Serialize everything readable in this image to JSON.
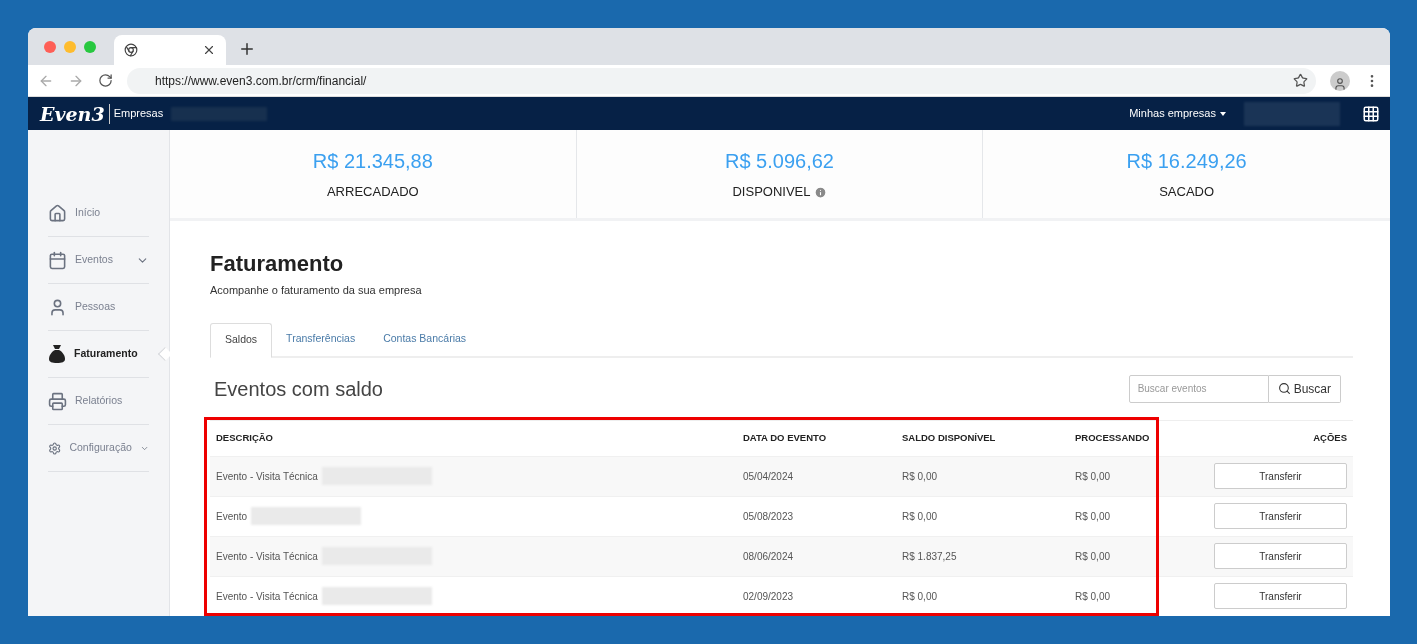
{
  "browser": {
    "url": "https://www.even3.com.br/crm/financial/"
  },
  "header": {
    "logo": "Even3",
    "product": "Empresas",
    "company_redacted": true,
    "menu": "Minhas empresas",
    "user_redacted": true
  },
  "sidebar": {
    "items": [
      {
        "label": "Início",
        "selected": false,
        "expandable": false
      },
      {
        "label": "Eventos",
        "selected": false,
        "expandable": true
      },
      {
        "label": "Pessoas",
        "selected": false,
        "expandable": false
      },
      {
        "label": "Faturamento",
        "selected": true,
        "expandable": false
      },
      {
        "label": "Relatórios",
        "selected": false,
        "expandable": false
      },
      {
        "label": "Configuração",
        "selected": false,
        "expandable": true
      }
    ]
  },
  "stats": [
    {
      "value": "R$ 21.345,88",
      "label": "ARRECADADO",
      "info": false
    },
    {
      "value": "R$ 5.096,62",
      "label": "DISPONIVEL",
      "info": true
    },
    {
      "value": "R$ 16.249,26",
      "label": "SACADO",
      "info": false
    }
  ],
  "page": {
    "title": "Faturamento",
    "subtitle": "Acompanhe o faturamento da sua empresa"
  },
  "tabs": [
    {
      "label": "Saldos",
      "selected": true
    },
    {
      "label": "Transferências",
      "selected": false
    },
    {
      "label": "Contas Bancárias",
      "selected": false
    }
  ],
  "section": {
    "title": "Eventos com saldo",
    "search": {
      "placeholder": "Buscar eventos",
      "button": "Buscar"
    }
  },
  "table": {
    "columns": [
      "DESCRIÇÃO",
      "DATA DO EVENTO",
      "SALDO DISPONÍVEL",
      "PROCESSANDO",
      "AÇÕES"
    ],
    "rows": [
      {
        "description": "Evento - Visita Técnica",
        "redacted": true,
        "date": "05/04/2024",
        "saldo": "R$ 0,00",
        "processando": "R$ 0,00",
        "action": "Transferir"
      },
      {
        "description": "Evento",
        "redacted": true,
        "date": "05/08/2023",
        "saldo": "R$ 0,00",
        "processando": "R$ 0,00",
        "action": "Transferir"
      },
      {
        "description": "Evento - Visita Técnica",
        "redacted": true,
        "date": "08/06/2024",
        "saldo": "R$ 1.837,25",
        "processando": "R$ 0,00",
        "action": "Transferir"
      },
      {
        "description": "Evento - Visita Técnica",
        "redacted": true,
        "date": "02/09/2023",
        "saldo": "R$ 0,00",
        "processando": "R$ 0,00",
        "action": "Transferir"
      }
    ]
  }
}
